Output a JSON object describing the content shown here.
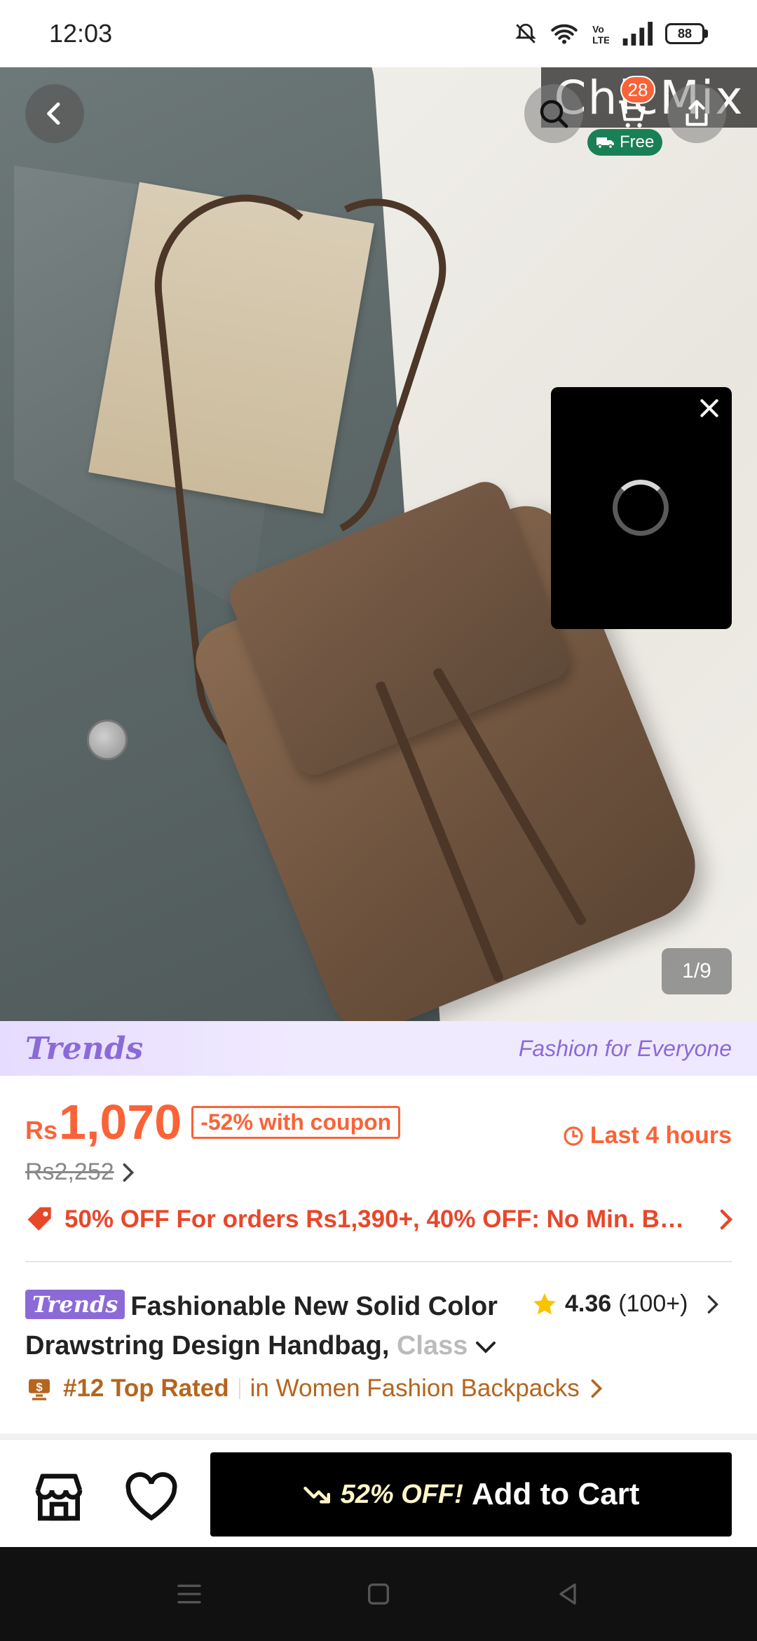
{
  "status_bar": {
    "time": "12:03",
    "battery": "88"
  },
  "header": {
    "cart_count": "28",
    "free_shipping_label": "Free",
    "watermark_text": "ChicMix"
  },
  "gallery": {
    "counter": "1/9"
  },
  "banner": {
    "brand": "Trends",
    "tagline": "Fashion for Everyone"
  },
  "pricing": {
    "currency": "Rs",
    "price": "1,070",
    "coupon_label": "-52% with coupon",
    "timer_label": "Last 4 hours",
    "original_price": "Rs2,252",
    "promo_text": "50% OFF For orders Rs1,390+,  40% OFF: No Min. B…"
  },
  "product": {
    "brand_chip": "Trends",
    "title_main": "Fashionable New Solid Color Drawstring Design Handbag, ",
    "title_fade": "Class",
    "rating_score": "4.36",
    "rating_count": "(100+)",
    "rank_label": "#12 Top Rated",
    "rank_category": "in Women Fashion Backpacks"
  },
  "actions": {
    "discount_label": "52% OFF!",
    "add_to_cart_label": "Add to Cart"
  },
  "colors": {
    "accent": "#fa6338",
    "trends_purple": "#8b6ad8",
    "free_green": "#198055",
    "rank_brown": "#b5651d"
  }
}
